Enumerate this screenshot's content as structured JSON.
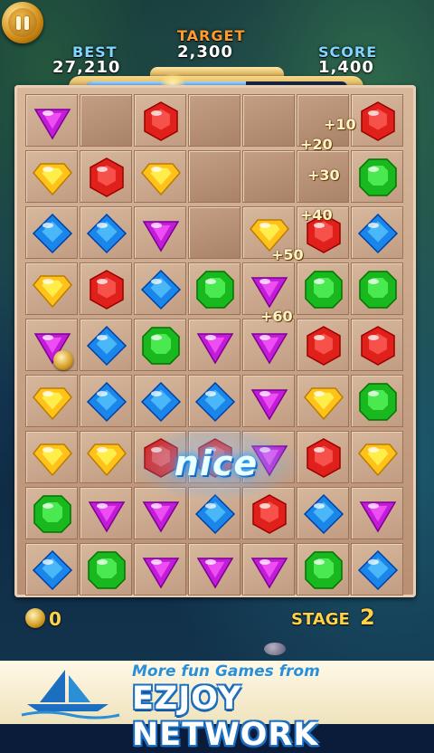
{
  "hud": {
    "best_label": "BEST",
    "best_value": "27,210",
    "target_label": "TARGET",
    "target_value": "2,300",
    "score_label": "SCORE",
    "score_value": "1,400",
    "progress_fraction": 0.61,
    "pause_icon": "pause-icon"
  },
  "board": {
    "rows": 9,
    "cols": 7,
    "gem_colors": {
      "purple": "#c21cd8",
      "red": "#e0201a",
      "yellow": "#ffc21a",
      "green": "#19b81e",
      "blue": "#1a86ea"
    },
    "grid": [
      [
        "purple",
        "empty",
        "red",
        "empty",
        "empty",
        "empty",
        "red"
      ],
      [
        "yellow",
        "red",
        "yellow",
        "empty",
        "empty",
        "empty",
        "green"
      ],
      [
        "blue",
        "blue",
        "purple",
        "empty",
        "yellow",
        "red",
        "blue"
      ],
      [
        "yellow",
        "red",
        "blue",
        "green",
        "purple",
        "green",
        "green"
      ],
      [
        "purple",
        "blue",
        "green",
        "purple",
        "purple",
        "red",
        "red"
      ],
      [
        "yellow",
        "blue",
        "blue",
        "blue",
        "purple",
        "yellow",
        "green"
      ],
      [
        "yellow",
        "yellow",
        "red",
        "red",
        "purple",
        "red",
        "yellow"
      ],
      [
        "green",
        "purple",
        "purple",
        "blue",
        "red",
        "blue",
        "purple"
      ],
      [
        "blue",
        "green",
        "purple",
        "purple",
        "purple",
        "green",
        "blue"
      ]
    ],
    "coin_cell": [
      4,
      0
    ]
  },
  "popups": [
    "+10",
    "+20",
    "+30",
    "+40",
    "+50",
    "+60"
  ],
  "combo_text": "nice",
  "footer": {
    "coins": "0",
    "stage_label": "STAGE",
    "stage_number": "2"
  },
  "ad": {
    "line1": "More fun Games from",
    "line2": "EZJOY NETWORK"
  }
}
